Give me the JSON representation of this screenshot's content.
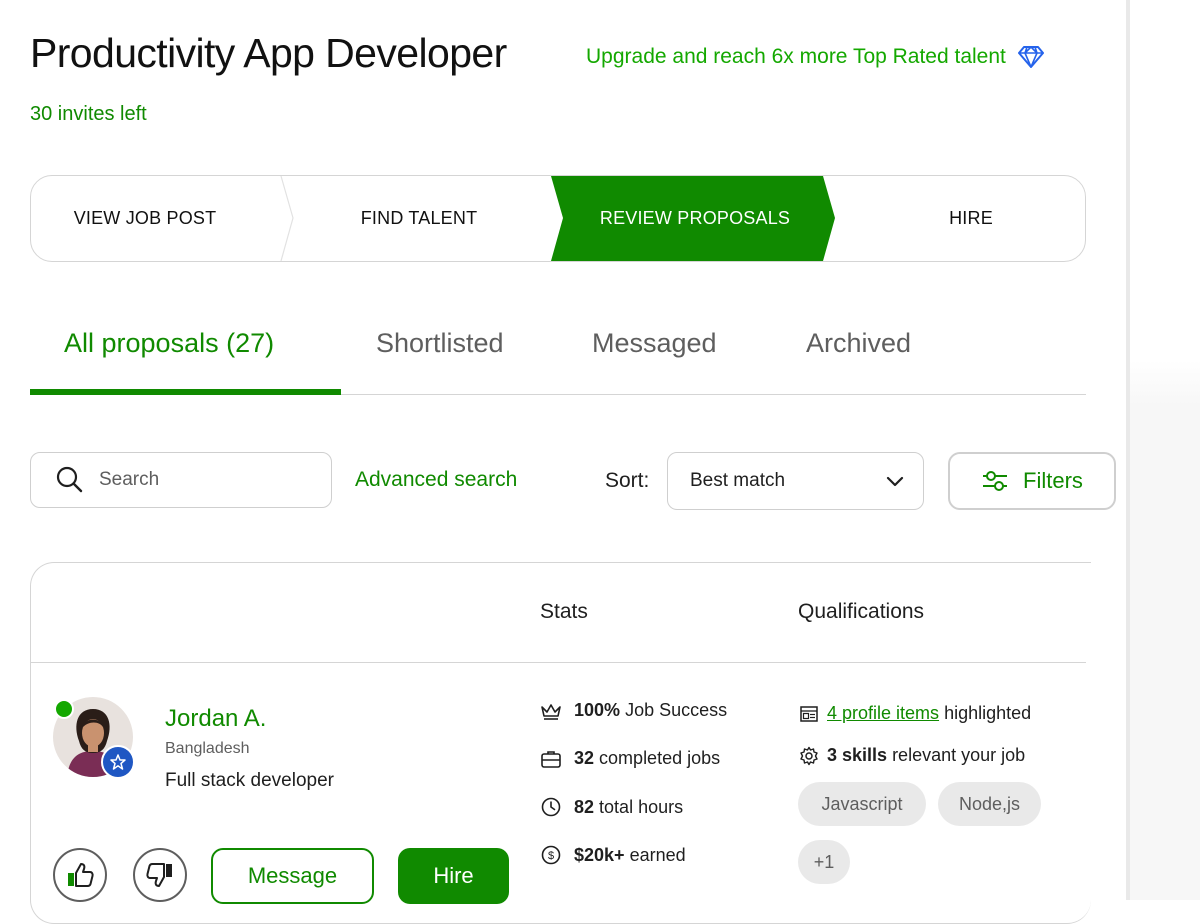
{
  "header": {
    "title": "Productivity App Developer",
    "upgrade_text": "Upgrade and reach 6x more Top Rated talent",
    "invites_left": "30 invites left"
  },
  "stepper": {
    "steps": [
      {
        "label": "VIEW JOB POST"
      },
      {
        "label": "FIND TALENT"
      },
      {
        "label": "REVIEW PROPOSALS"
      },
      {
        "label": "HIRE"
      }
    ],
    "active_step": "REVIEW PROPOSALS"
  },
  "tabs": [
    {
      "label": "All proposals (27)"
    },
    {
      "label": "Shortlisted"
    },
    {
      "label": "Messaged"
    },
    {
      "label": "Archived"
    }
  ],
  "toolbar": {
    "search_placeholder": "Search",
    "advanced_search": "Advanced search",
    "sort_label": "Sort:",
    "sort_value": "Best match",
    "filters_label": "Filters"
  },
  "table": {
    "col_stats": "Stats",
    "col_qualifications": "Qualifications"
  },
  "proposal": {
    "name": "Jordan A.",
    "country": "Bangladesh",
    "title": "Full stack developer",
    "stats": {
      "job_success_value": "100%",
      "job_success_label": "Job Success",
      "jobs_value": "32",
      "jobs_label": "completed jobs",
      "hours_value": "82",
      "hours_label": "total hours",
      "earned_value": "$20k+",
      "earned_label": "earned"
    },
    "qualifications": {
      "profile_items_link": "4 profile items",
      "profile_items_suffix": "highlighted",
      "skills_value": "3 skills",
      "skills_suffix": "relevant your job",
      "skill_chips": [
        "Javascript",
        "Node,js"
      ],
      "more_chip": "+1"
    },
    "actions": {
      "message": "Message",
      "hire": "Hire"
    }
  },
  "colors": {
    "brand_green": "#108a00",
    "accent_green": "#14a800",
    "badge_blue": "#1f57c3"
  },
  "icons": [
    "diamond-icon",
    "search-icon",
    "chevron-down-icon",
    "sliders-icon",
    "crown-icon",
    "briefcase-icon",
    "clock-icon",
    "dollar-circle-icon",
    "profile-items-icon",
    "gear-icon",
    "thumbs-up-icon",
    "thumbs-down-icon",
    "top-rated-badge-icon"
  ]
}
